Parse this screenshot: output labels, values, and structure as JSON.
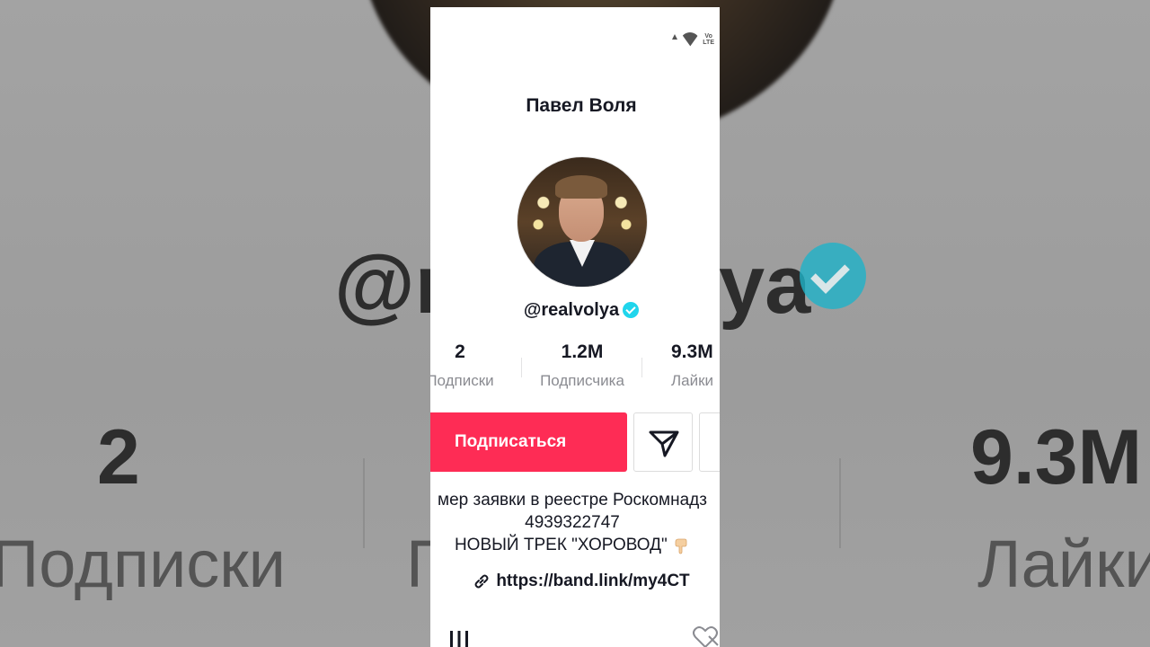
{
  "background": {
    "handle_left": "@r",
    "handle_right": "ya",
    "num_left": "2",
    "num_right": "9.3M",
    "label_left": "Подписки",
    "label_mid": "П          ка",
    "label_right": "Лайки"
  },
  "profile": {
    "title": "Павел Воля",
    "handle": "@realvolya",
    "verified": true
  },
  "stats": [
    {
      "value": "2",
      "label": "Подписки"
    },
    {
      "value": "1.2M",
      "label": "Подписчика"
    },
    {
      "value": "9.3M",
      "label": "Лайки"
    }
  ],
  "actions": {
    "follow_label": "Подписаться"
  },
  "bio": {
    "line1": "мер заявки в реестре Роскомнадз",
    "line2": "4939322747",
    "line3": "НОВЫЙ ТРЕК \"ХОРОВОД\" ",
    "link": "https://band.link/my4CT"
  },
  "colors": {
    "accent": "#fe2c55",
    "verified": "#20d5ec",
    "text": "#161823",
    "muted": "#8a8b91"
  },
  "icons": {
    "share": "send-icon",
    "grid": "grid-icon",
    "liked": "hidden-heart-icon",
    "link": "link-icon",
    "emoji": "pointing-down-emoji"
  }
}
